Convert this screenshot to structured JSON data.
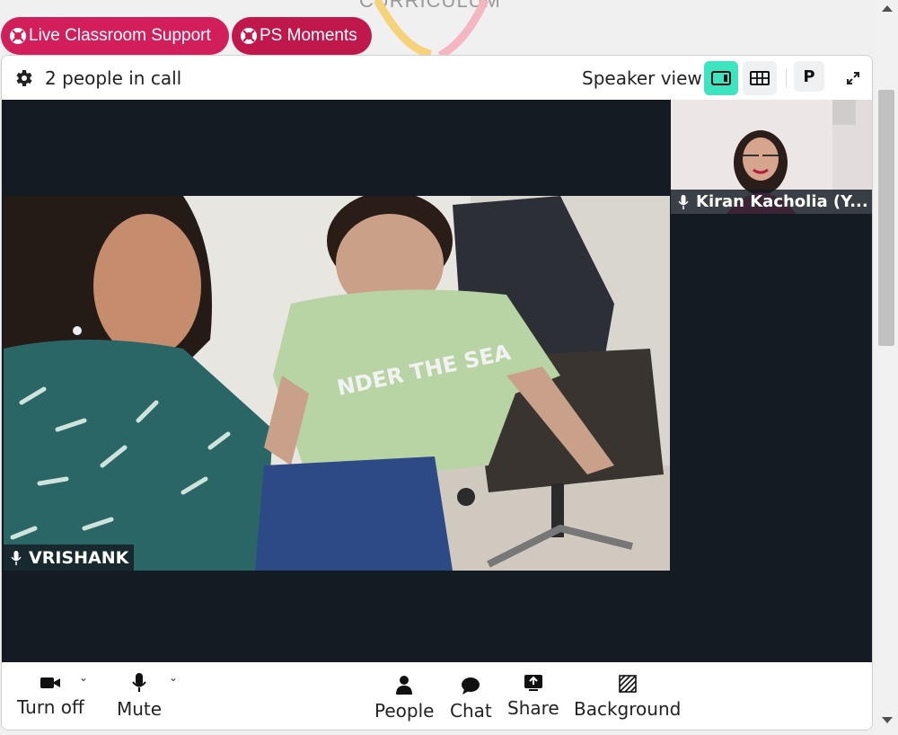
{
  "page": {
    "background_heading": "CURRICULUM"
  },
  "pills": {
    "live_support_label": "Live Classroom Support",
    "ps_moments_label": "PS Moments",
    "live_support_color": "#d21f5c",
    "ps_moments_color": "#c0184d"
  },
  "call": {
    "people_count_text": "2 people in call",
    "speaker_view_label": "Speaker view",
    "p_button_label": "P",
    "active_view": "speaker",
    "accent_color": "#3ee4c0"
  },
  "videos": {
    "main": {
      "name": "VRISHANK",
      "mic": "mic-icon",
      "shirt_text": "NDER THE SEA"
    },
    "thumbnail": {
      "name": "Kiran Kacholia (Y...",
      "mic": "mic-icon"
    }
  },
  "toolbar": {
    "camera_label": "Turn off",
    "mute_label": "Mute",
    "people_label": "People",
    "chat_label": "Chat",
    "share_label": "Share",
    "background_label": "Background"
  }
}
